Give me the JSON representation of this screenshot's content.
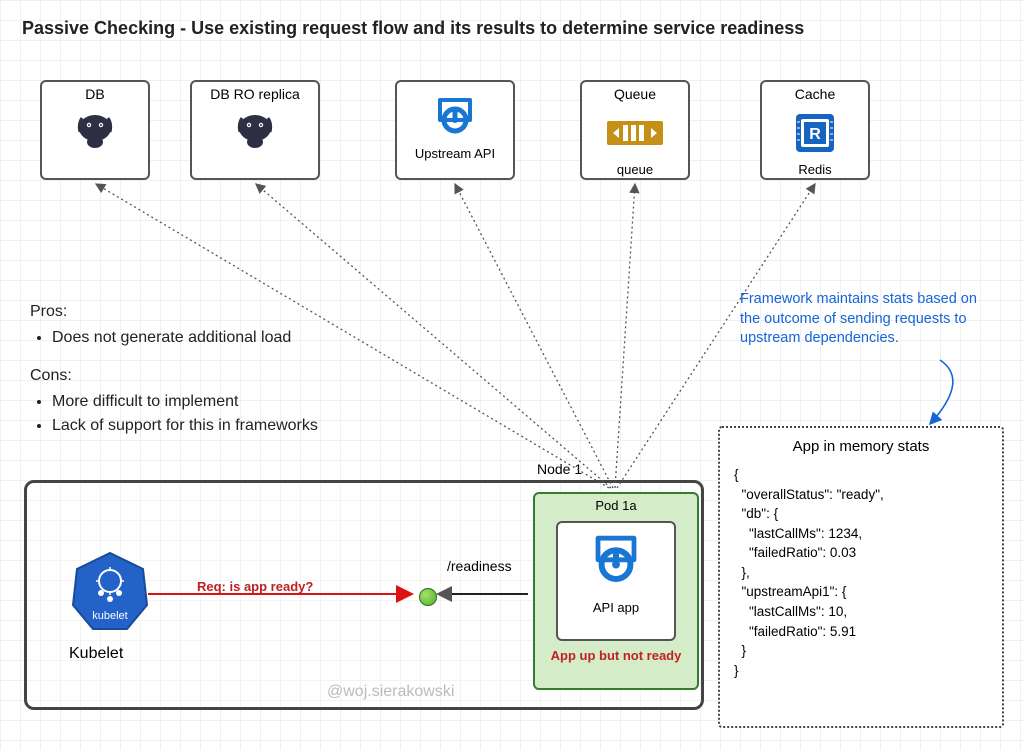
{
  "title": "Passive Checking - Use existing request flow and its results to determine service readiness",
  "deps": {
    "db": {
      "label": "DB"
    },
    "db_ro": {
      "label": "DB RO replica"
    },
    "upstream": {
      "label": "",
      "sublabel": "Upstream API"
    },
    "queue": {
      "label": "Queue",
      "sublabel": "queue"
    },
    "cache": {
      "label": "Cache",
      "sublabel": "Redis"
    }
  },
  "pros_heading": "Pros:",
  "pros": [
    "Does not generate additional load"
  ],
  "cons_heading": "Cons:",
  "cons": [
    "More difficult to implement",
    "Lack of support for this in frameworks"
  ],
  "callout": "Framework maintains stats based on the outcome of sending requests to upstream dependencies.",
  "node_label": "Node 1",
  "pod_label": "Pod 1a",
  "api_app_label": "API app",
  "pod_status": "App up but not ready",
  "kubelet_label": "Kubelet",
  "kubelet_icon_text": "kubelet",
  "request_label": "Req: is app ready?",
  "readiness_label": "/readiness",
  "watermark": "@woj.sierakowski",
  "stats_header": "App in memory stats",
  "stats_body": "{\n  \"overallStatus\": \"ready\",\n  \"db\": {\n    \"lastCallMs\": 1234,\n    \"failedRatio\": 0.03\n  },\n  \"upstreamApi1\": {\n    \"lastCallMs\": 10,\n    \"failedRatio\": 5.91\n  }\n}"
}
